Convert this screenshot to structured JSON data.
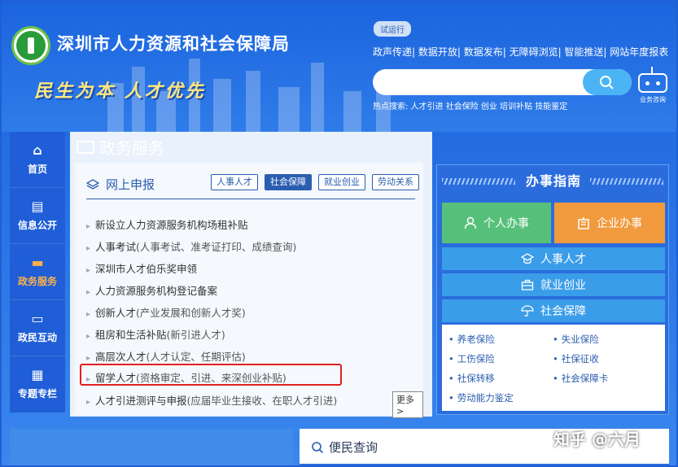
{
  "header": {
    "site_title": "深圳市人力资源和社会保障局",
    "slogan": "民生为本 人才优先",
    "trial_badge": "试运行",
    "top_links": "政声传递| 数据开放| 数据发布| 无障碍浏览| 智能推送| 网站年度报表",
    "search_placeholder": "",
    "hot_search": "热点搜索:  人才引进  社会保险  创业  培训补贴  技能鉴定",
    "assistant_label": "业务咨询"
  },
  "sidebar": {
    "items": [
      {
        "label": "首页",
        "icon": "home-icon",
        "glyph": "⌂"
      },
      {
        "label": "信息公开",
        "icon": "clipboard-icon",
        "glyph": "▤"
      },
      {
        "label": "政务服务",
        "icon": "folder-icon",
        "glyph": "▬"
      },
      {
        "label": "政民互动",
        "icon": "chat-icon",
        "glyph": "▭"
      },
      {
        "label": "专题专栏",
        "icon": "grid-icon",
        "glyph": "▦"
      }
    ]
  },
  "main": {
    "section_title": "政务服务",
    "online_title": "网上申报",
    "tabs": [
      "人事人才",
      "社会保障",
      "就业创业",
      "劳动关系"
    ],
    "active_tab": "社会保障",
    "items": [
      {
        "main": "新设立人力资源服务机构场租补贴",
        "sub": ""
      },
      {
        "main": "人事考试",
        "sub": "(人事考试、准考证打印、成绩查询)"
      },
      {
        "main": "深圳市人才伯乐奖申领",
        "sub": ""
      },
      {
        "main": "人力资源服务机构登记备案",
        "sub": ""
      },
      {
        "main": "创新人才",
        "sub": "(产业发展和创新人才奖)"
      },
      {
        "main": "租房和生活补贴",
        "sub": "(新引进人才)"
      },
      {
        "main": "高层次人才",
        "sub": "(人才认定、任期评估)"
      },
      {
        "main": "留学人才",
        "sub": "(资格审定、引进、来深创业补贴)"
      },
      {
        "main": "人才引进测评与申报",
        "sub": "(应届毕业生接收、在职人才引进)"
      }
    ],
    "more_label": "更多>"
  },
  "guide": {
    "title": "办事指南",
    "personal_label": "个人办事",
    "enterprise_label": "企业办事",
    "talent_label": "人事人才",
    "job_label": "就业创业",
    "ss_label": "社会保障",
    "ss_items": [
      "养老保险",
      "失业保险",
      "工伤保险",
      "社保征收",
      "社保转移",
      "社会保障卡",
      "劳动能力鉴定"
    ]
  },
  "bottom": {
    "convenience_label": "便民查询",
    "watermark": "知乎 @六月"
  },
  "colors": {
    "brand_blue": "#1b64de",
    "highlight_red": "#e02020",
    "personal_green": "#56c07a",
    "enterprise_orange": "#f19a3e",
    "active_orange": "#ffb14a"
  }
}
